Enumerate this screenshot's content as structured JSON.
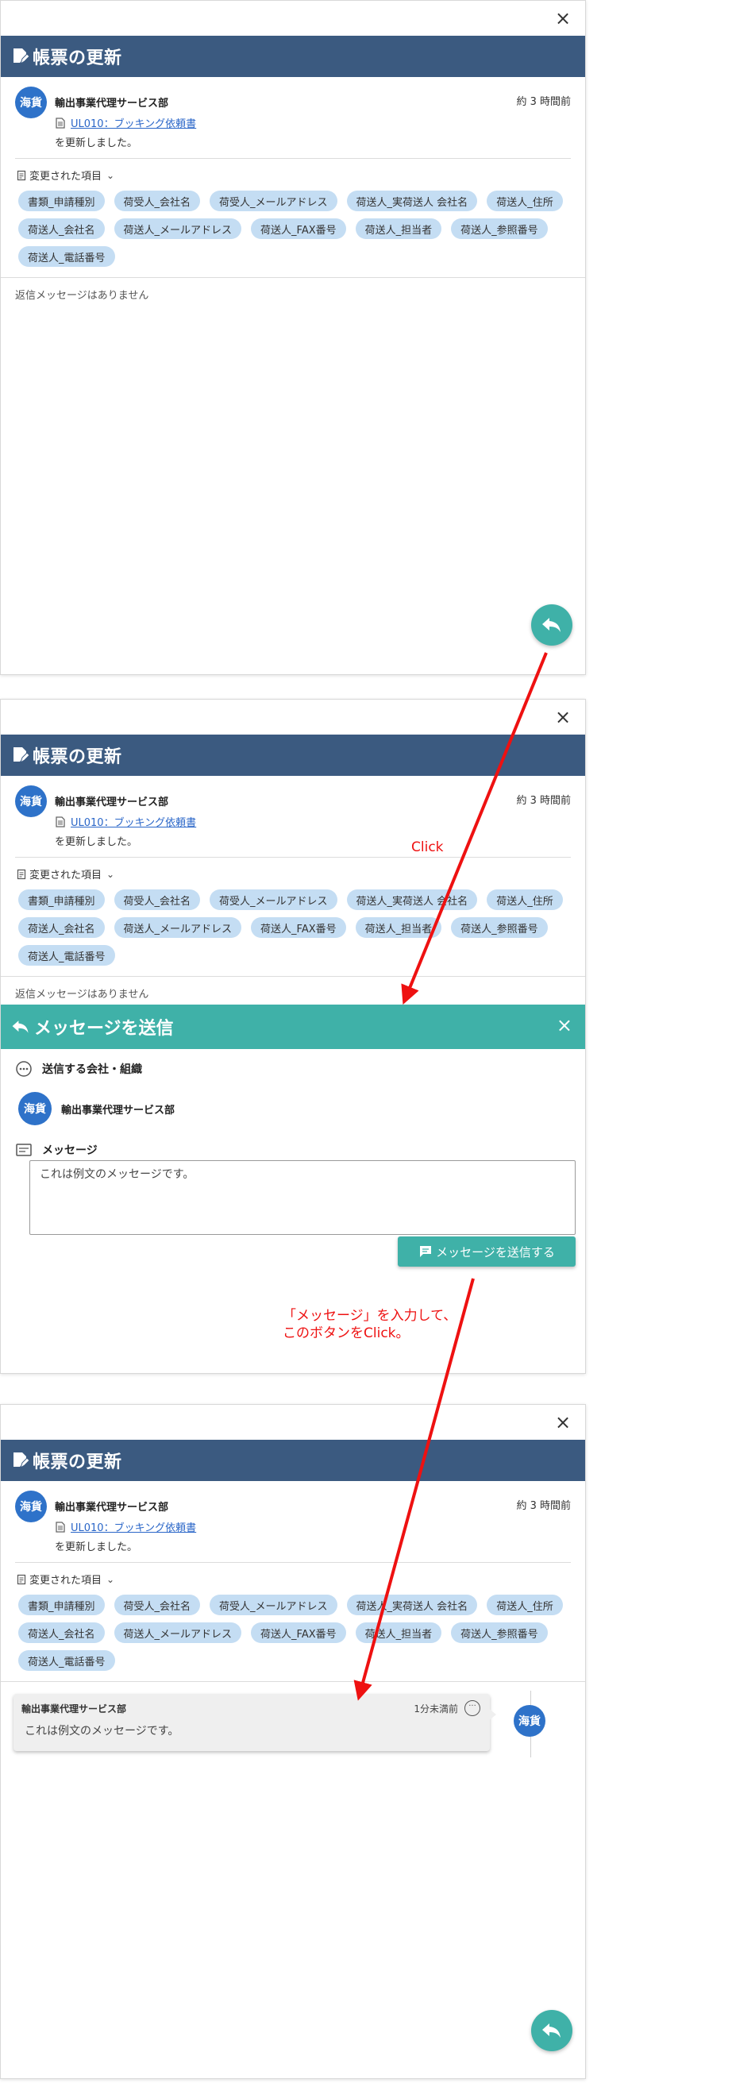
{
  "panel": {
    "close_symbol": "×",
    "header_title": "帳票の更新",
    "avatar_text": "海貨",
    "org_name": "輸出事業代理サービス部",
    "time_ago": "約 3 時間前",
    "doc_link": "UL010：ブッキング依頼書",
    "updated_text": "を更新しました。",
    "changed_items_label": "変更された項目",
    "chevron_symbol": "⌄",
    "chips": [
      "書類_申請種別",
      "荷受人_会社名",
      "荷受人_メールアドレス",
      "荷送人_実荷送人 会社名",
      "荷送人_住所",
      "荷送人_会社名",
      "荷送人_メールアドレス",
      "荷送人_FAX番号",
      "荷送人_担当者",
      "荷送人_参照番号",
      "荷送人_電話番号"
    ],
    "no_reply": "返信メッセージはありません",
    "icons": [
      "edit-doc-icon",
      "document-icon",
      "list-icon",
      "reply-icon"
    ]
  },
  "send_form": {
    "header_title": "メッセージを送信",
    "close_symbol": "×",
    "recipient_label": "送信する会社・組織",
    "recipient_avatar": "海貨",
    "recipient_org": "輸出事業代理サービス部",
    "message_label": "メッセージ",
    "message_value": "これは例文のメッセージです。",
    "send_button": "メッセージを送信する"
  },
  "thread": {
    "org": "輸出事業代理サービス部",
    "time": "1分未満前",
    "more_symbol": "···",
    "text": "これは例文のメッセージです。",
    "avatar_text": "海貨"
  },
  "annotations": {
    "click": "Click",
    "instruction_line1": "「メッセージ」を入力して、",
    "instruction_line2": "このボタンをClick。"
  },
  "colors": {
    "header_blue": "#3b5a80",
    "teal": "#3fb1a8",
    "chip_blue": "#c4ddf3",
    "avatar_blue": "#2e72c9",
    "annotation_red": "#ee1111"
  }
}
